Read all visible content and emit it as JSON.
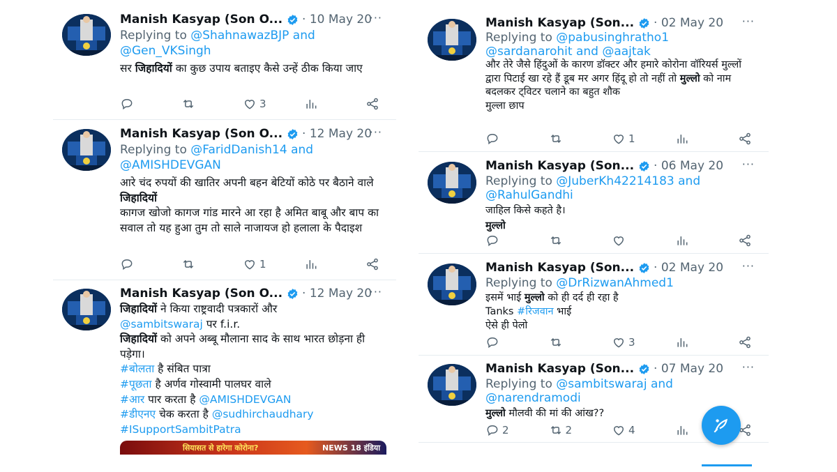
{
  "colors": {
    "accent": "#1d9bf0",
    "muted": "#536471",
    "text": "#0f1419"
  },
  "icons": {
    "verified": "verified-badge-icon",
    "reply": "reply-icon",
    "retweet": "retweet-icon",
    "like": "heart-icon",
    "views": "analytics-icon",
    "share": "share-icon",
    "more": "more-icon",
    "compose": "compose-tweet-icon"
  },
  "left_tweets": [
    {
      "name": "Manish Kasyap (Son O...",
      "date": "· 10 May 20",
      "more": "···",
      "replying_prefix": "Replying to",
      "mentions": [
        "@ShahnawazBJP",
        "and",
        "@Gen_VKSingh"
      ],
      "text_plain_1": "सर ",
      "text_bold_1": "जिहादियों",
      "text_plain_2": " का कुछ उपाय बताइए कैसे उन्हें ठीक किया जाए",
      "reply_count": "",
      "retweet_count": "",
      "like_count": "3"
    },
    {
      "name": "Manish Kasyap (Son O...",
      "date": "· 12 May 20",
      "more": "···",
      "replying_prefix": "Replying to",
      "mentions": [
        "@FaridDanish14",
        "and",
        "@AMISHDEVGAN"
      ],
      "line1": "आरे चंद रुपयों की खातिर अपनी बहन बेटियों कोठे पर बैठाने वाले ",
      "line1_bold": "जिहादियों",
      "line2": "कागज खोजो कागज गांड मारने आ रहा है अमित बाबू और बाप का सवाल तो यह हुआ तुम तो साले नाजायज हो हलाला के पैदाइश",
      "reply_count": "",
      "retweet_count": "",
      "like_count": "1"
    },
    {
      "name": "Manish Kasyap (Son O...",
      "date": "· 12 May 20",
      "more": "···",
      "l1_bold": "जिहादियों",
      "l1_plain": " ने किया राष्ट्रवादी पत्रकारों और",
      "l2_mention": "@sambitswaraj",
      "l2_plain": " पर f.i.r.",
      "l3_bold": "जिहादियों",
      "l3_plain": " को अपने अब्बू मौलाना साद के साथ भारत छोड़ना ही पड़ेगा।",
      "h1_tag": "#बोलता",
      "h1_plain": " है संबित पात्रा",
      "h2_tag": "#पूछता",
      "h2_plain": " है अर्णव गोस्वामी पालघर वाले",
      "h3_tag": "#आर",
      "h3_plain": " पार करता है ",
      "h3_mention": "@AMISHDEVGAN",
      "h4_tag": "#डीएनए",
      "h4_plain": " चेक करता है ",
      "h4_mention": "@sudhirchaudhary",
      "h5_tag": "#ISupportSambitPatra",
      "media_caption": "सियासत से हारेगा कोरोना?",
      "media_logo": "NEWS 18 इंडिया"
    }
  ],
  "right_tweets": [
    {
      "name": "Manish Kasyap (Son...",
      "date": "· 02 May 20",
      "more": "···",
      "replying_prefix": "Replying to",
      "mention_1": "@pabusinghratho1",
      "mention_2": "@sardanarohit",
      "and": "and",
      "mention_3": "@aajtak",
      "t1": "और तेरे जैसे हिंदुओं के कारण डॉक्टर और हमारे कोरोना वॉरियर्स मुल्लों द्वारा पिटाई खा रहे हैं डूब मर अगर हिंदू हो तो नहीं तो ",
      "t1_bold": "मुल्लो",
      "t1_end": " को नाम बदलकर ट्विटर चलाने का बहुत शौक",
      "t2": "मुल्ला छाप",
      "like_count": "1"
    },
    {
      "name": "Manish Kasyap (Son...",
      "date": "· 06 May 20",
      "more": "···",
      "replying_prefix": "Replying to",
      "mention_1": "@JuberKh42214183",
      "and": "and",
      "mention_2": "@RahulGandhi",
      "t1": "जाहिल किसे कहते है।",
      "t2_bold": "मुल्लो"
    },
    {
      "name": "Manish Kasyap (Son...",
      "date": "· 02 May 20",
      "more": "···",
      "replying_prefix": "Replying to",
      "mention_1": "@DrRizwanAhmed1",
      "t1": "इसमें भाई ",
      "t1_bold": "मुल्लो",
      "t1_end": " को ही दर्द ही रहा है",
      "t2": "Tanks ",
      "t2_tag": "#रिजवान",
      "t2_end": " भाई",
      "t3": "ऐसे ही पेलो",
      "like_count": "3"
    },
    {
      "name": "Manish Kasyap (Son...",
      "date": "· 07 May 20",
      "more": "···",
      "replying_prefix": "Replying to",
      "mention_1": "@sambitswaraj",
      "and": "and",
      "mention_2": "@narendramodi",
      "t1_bold": "मुल्लो",
      "t1": " मौलवी की मां की आंख??",
      "reply_count": "2",
      "retweet_count": "2",
      "like_count": "4"
    }
  ]
}
